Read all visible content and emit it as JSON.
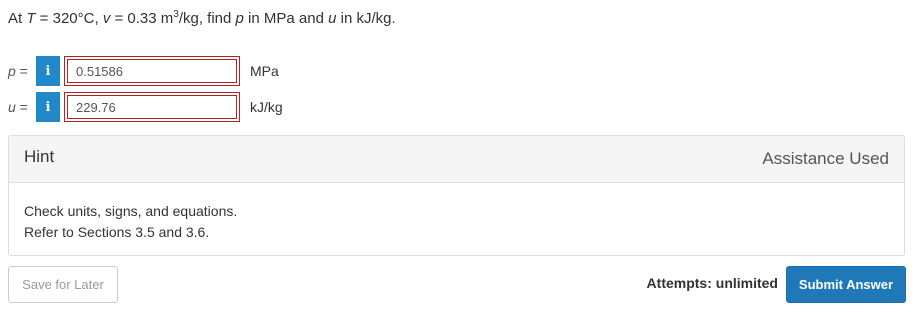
{
  "question": {
    "prefix": "At ",
    "T_var": "T",
    "T_text": " = 320°C, ",
    "v_var": "v",
    "v_text": " = 0.33 m",
    "v_exp": "3",
    "v_unit_tail": "/kg, find ",
    "p_var": "p",
    "mid": " in MPa and ",
    "u_var": "u",
    "suffix": " in kJ/kg."
  },
  "answers": [
    {
      "var": "p",
      "eq": " =",
      "info_icon": "i",
      "value": "0.51586",
      "unit": "MPa"
    },
    {
      "var": "u",
      "eq": " =",
      "info_icon": "i",
      "value": "229.76",
      "unit": "kJ/kg"
    }
  ],
  "hint": {
    "title": "Hint",
    "assistance_label": "Assistance Used",
    "lines": [
      "Check units, signs, and equations.",
      "Refer to Sections 3.5 and 3.6."
    ]
  },
  "footer": {
    "save_label": "Save for Later",
    "attempts_label": "Attempts: unlimited",
    "submit_label": "Submit Answer"
  },
  "colors": {
    "info_button": "#2188c9",
    "input_border_error": "#b22222",
    "submit_button": "#1f79b8"
  }
}
